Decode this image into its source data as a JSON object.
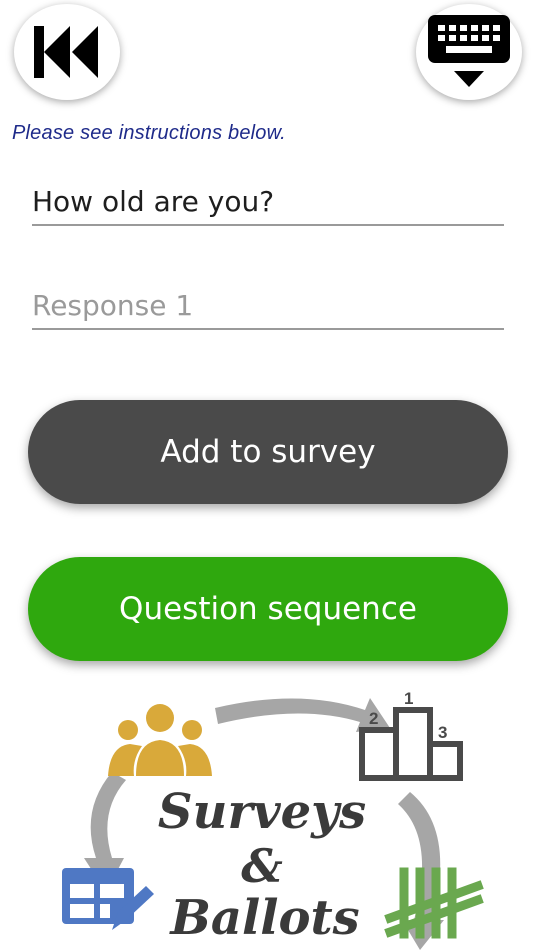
{
  "instructions": "Please see instructions below.",
  "question": {
    "value": "How old are you?"
  },
  "response": {
    "placeholder": "Response 1"
  },
  "buttons": {
    "add_to_survey": "Add to survey",
    "question_sequence": "Question sequence"
  },
  "logo": {
    "line1": "Surveys",
    "line2": "&",
    "line3": "Ballots",
    "podium_labels": [
      "2",
      "1",
      "3"
    ]
  },
  "colors": {
    "add_button": "#4a4a4a",
    "sequence_button": "#2fa80e",
    "instructions_text": "#1f2b8a",
    "people_icon": "#d9a93a",
    "table_icon": "#4f78c4",
    "tally_icon": "#6aa84f",
    "arrows": "#a6a6a6"
  },
  "icons": {
    "back": "skip-back-icon",
    "keyboard": "keyboard-hide-icon"
  }
}
